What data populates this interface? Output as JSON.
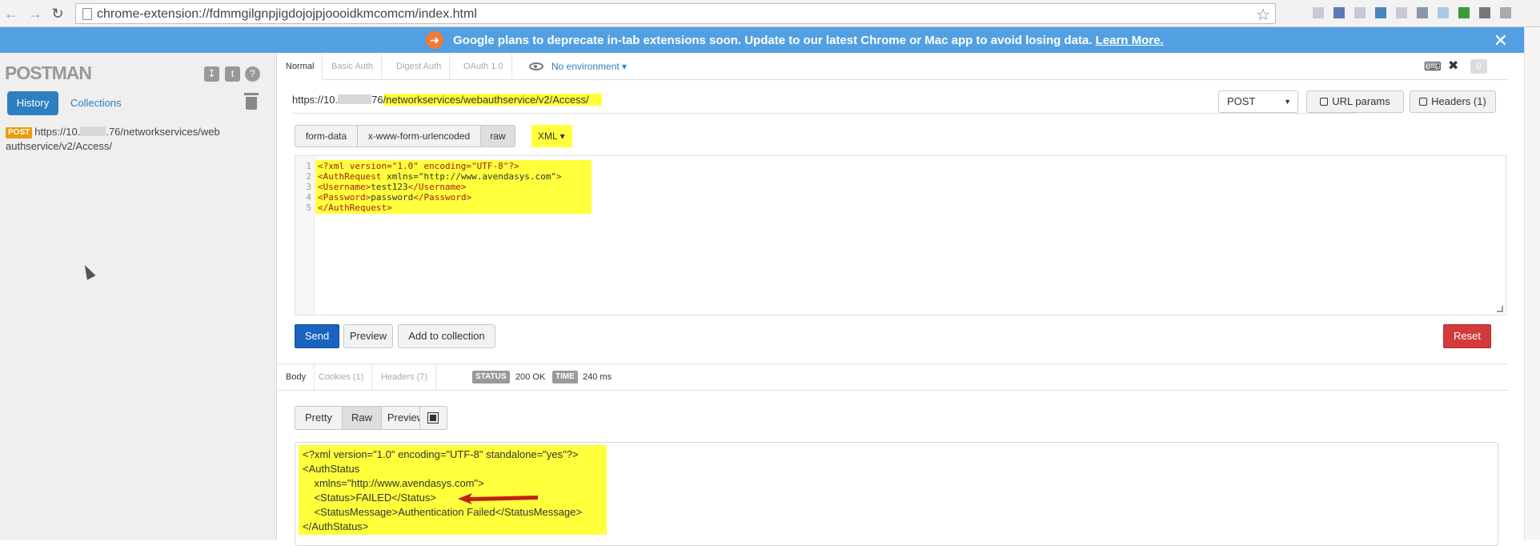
{
  "browser": {
    "url": "chrome-extension://fdmmgilgnpjigdojojpjoooidkmcomcm/index.html"
  },
  "banner": {
    "message": "Google plans to deprecate in-tab extensions soon. Update to our latest Chrome or Mac app to avoid losing data.",
    "link": "Learn More."
  },
  "sidebar": {
    "brand": "POSTMAN",
    "tabs": {
      "history": "History",
      "collections": "Collections"
    },
    "history_item": {
      "method": "POST",
      "url_start": "https://10.",
      "url_end": ".76/networkservices/web authservice/v2/Access/"
    }
  },
  "auth_tabs": [
    "Normal",
    "Basic Auth",
    "Digest Auth",
    "OAuth 1.0"
  ],
  "environment": "No environment",
  "badge_count": "0",
  "request": {
    "url_start": "https://10.",
    "url_mid": "76",
    "url_highlight": "/networkservices/webauthservice/v2/Access/",
    "method": "POST",
    "url_params_label": "URL params",
    "headers_label": "Headers (1)"
  },
  "body_tabs": [
    "form-data",
    "x-www-form-urlencoded",
    "raw"
  ],
  "body_type": "XML",
  "editor_lines": [
    "1",
    "2",
    "3",
    "4",
    "5"
  ],
  "actions": {
    "send": "Send",
    "preview": "Preview",
    "add": "Add to collection",
    "reset": "Reset"
  },
  "response": {
    "tabs": [
      "Body",
      "Cookies (1)",
      "Headers (7)"
    ],
    "status_label": "STATUS",
    "status_value": "200 OK",
    "time_label": "TIME",
    "time_value": "240 ms",
    "formats": [
      "Pretty",
      "Raw",
      "Preview"
    ]
  },
  "colors": {
    "banner": "#52a0e2",
    "send": "#1a63c1",
    "reset": "#d53a3a",
    "highlight": "#ffff3c"
  }
}
